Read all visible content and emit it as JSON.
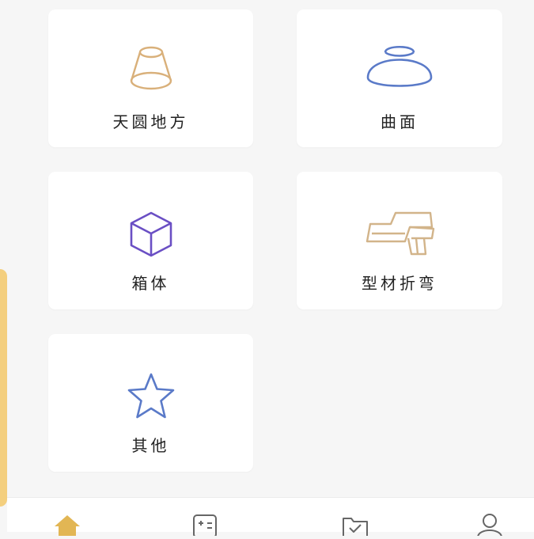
{
  "categories": [
    {
      "label": "天圆地方",
      "icon": "frustum-icon",
      "color": "#d9b07a"
    },
    {
      "label": "曲面",
      "icon": "dome-icon",
      "color": "#5a7ac8"
    },
    {
      "label": "箱体",
      "icon": "cube-icon",
      "color": "#6a4fc4"
    },
    {
      "label": "型材折弯",
      "icon": "profile-bend-icon",
      "color": "#d2b48a"
    },
    {
      "label": "其他",
      "icon": "star-icon",
      "color": "#5a7ac8"
    }
  ],
  "tabbar": {
    "items": [
      {
        "icon": "home-icon",
        "active": true
      },
      {
        "icon": "calculator-icon",
        "active": false
      },
      {
        "icon": "folder-check-icon",
        "active": false
      },
      {
        "icon": "user-icon",
        "active": false
      }
    ]
  },
  "colors": {
    "accent": "#f4cf7e",
    "home_active": "#e2b654",
    "tab_inactive": "#666666"
  }
}
